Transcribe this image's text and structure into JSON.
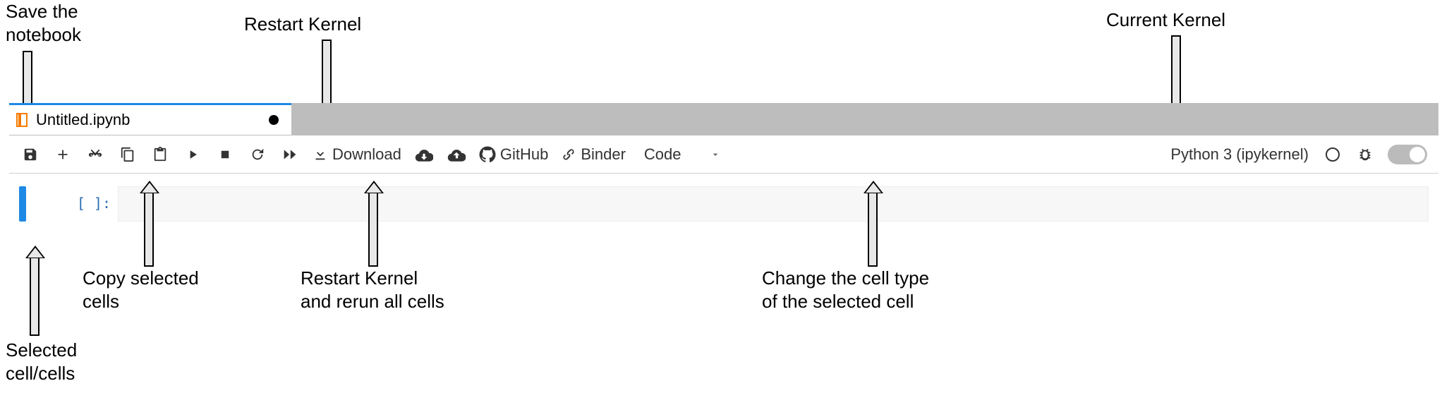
{
  "annotations": {
    "save_notebook": "Save the\nnotebook",
    "restart_kernel": "Restart Kernel",
    "current_kernel": "Current Kernel",
    "copy_cells": "Copy selected\ncells",
    "restart_rerun": "Restart Kernel\nand rerun all cells",
    "change_cell_type": "Change the cell type\nof the selected cell",
    "selected_cells": "Selected\ncell/cells"
  },
  "tab": {
    "title": "Untitled.ipynb",
    "dirty": true
  },
  "toolbar": {
    "download_label": "Download",
    "github_label": "GitHub",
    "binder_label": "Binder",
    "cell_type_value": "Code",
    "kernel_label": "Python 3 (ipykernel)"
  },
  "cell": {
    "prompt": "[ ]:",
    "source": ""
  }
}
